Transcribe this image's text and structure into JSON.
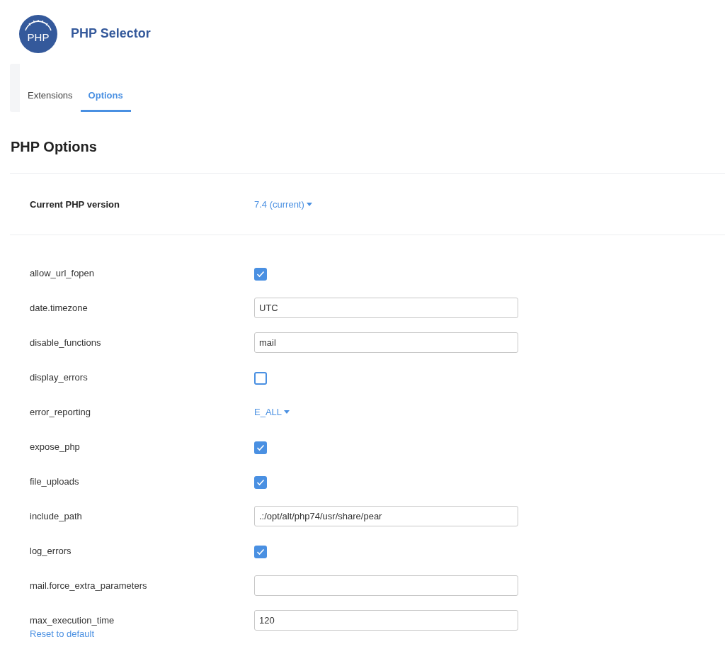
{
  "app": {
    "title": "PHP Selector",
    "logo_text": "PHP"
  },
  "tabs": [
    {
      "label": "Extensions",
      "selected": false
    },
    {
      "label": "Options",
      "selected": true
    }
  ],
  "heading": "PHP Options",
  "version": {
    "label": "Current PHP version",
    "value": "7.4 (current)"
  },
  "options": [
    {
      "name": "allow_url_fopen",
      "kind": "checkbox",
      "checked": true
    },
    {
      "name": "date.timezone",
      "kind": "text",
      "value": "UTC"
    },
    {
      "name": "disable_functions",
      "kind": "text",
      "value": "mail"
    },
    {
      "name": "display_errors",
      "kind": "checkbox",
      "checked": false
    },
    {
      "name": "error_reporting",
      "kind": "dropdown",
      "value": "E_ALL"
    },
    {
      "name": "expose_php",
      "kind": "checkbox",
      "checked": true
    },
    {
      "name": "file_uploads",
      "kind": "checkbox",
      "checked": true
    },
    {
      "name": "include_path",
      "kind": "text",
      "value": ".:/opt/alt/php74/usr/share/pear"
    },
    {
      "name": "log_errors",
      "kind": "checkbox",
      "checked": true
    },
    {
      "name": "mail.force_extra_parameters",
      "kind": "text"
    },
    {
      "name": "max_execution_time",
      "kind": "text",
      "value": "120",
      "reset_link": "Reset to default"
    }
  ]
}
